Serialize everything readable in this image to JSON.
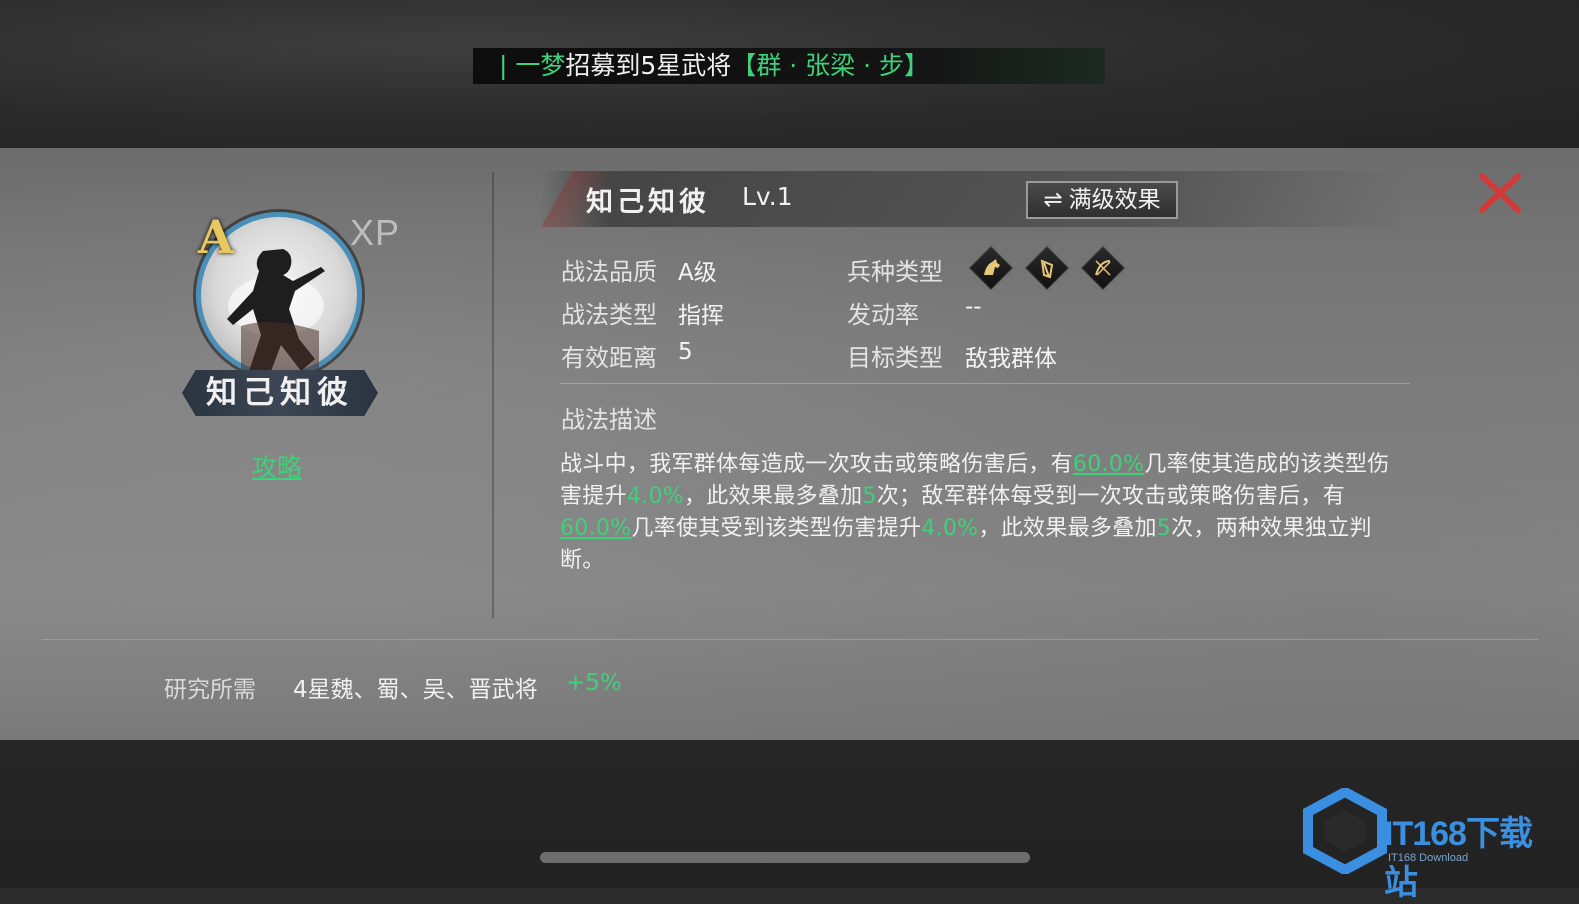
{
  "notice": {
    "bar": "|",
    "user": "一梦",
    "text": "招募到5星武将",
    "bracket_open": "【",
    "hero": "群 · 张梁 · 步",
    "bracket_close": "】"
  },
  "hero_card": {
    "grade": "A",
    "xp_tag": "XP",
    "skill_name_plate": "知己知彼",
    "guide_link": "攻略"
  },
  "skill": {
    "title": "知己知彼",
    "level": "Lv.1",
    "max_level_button": "满级效果",
    "swap_icon": "⇌"
  },
  "attributes": {
    "quality_label": "战法品质",
    "quality_value": "A级",
    "type_label": "战法类型",
    "type_value": "指挥",
    "range_label": "有效距离",
    "range_value": "5",
    "troop_label": "兵种类型",
    "troop_icons": [
      "cavalry-icon",
      "shield-icon",
      "bow-icon"
    ],
    "rate_label": "发动率",
    "rate_value": "--",
    "target_label": "目标类型",
    "target_value": "敌我群体"
  },
  "description": {
    "heading": "战法描述",
    "p1": "战斗中，我军群体每造成一次攻击或策略伤害后，有",
    "v1": "60.0%",
    "p2": "几率使其造成的该类型伤害提升",
    "v2": "4.0%",
    "p3": "，此效果最多叠加",
    "v3": "5",
    "p4": "次；敌军群体每受到一次攻击或策略伤害后，有",
    "v4": "60.0%",
    "p5": "几率使其受到该类型伤害提升",
    "v5": "4.0%",
    "p6": "，此效果最多叠加",
    "v6": "5",
    "p7": "次，两种效果独立判断。"
  },
  "research": {
    "label": "研究所需",
    "value": "4星魏、蜀、吴、晋武将",
    "bonus": "+5%"
  },
  "watermark": {
    "brand": "IT168下载站",
    "sub": "IT168 Download"
  },
  "colors": {
    "accent_green": "#3fd07a",
    "close_red": "#d23a3a",
    "grade_gold": "#e9c95d"
  }
}
